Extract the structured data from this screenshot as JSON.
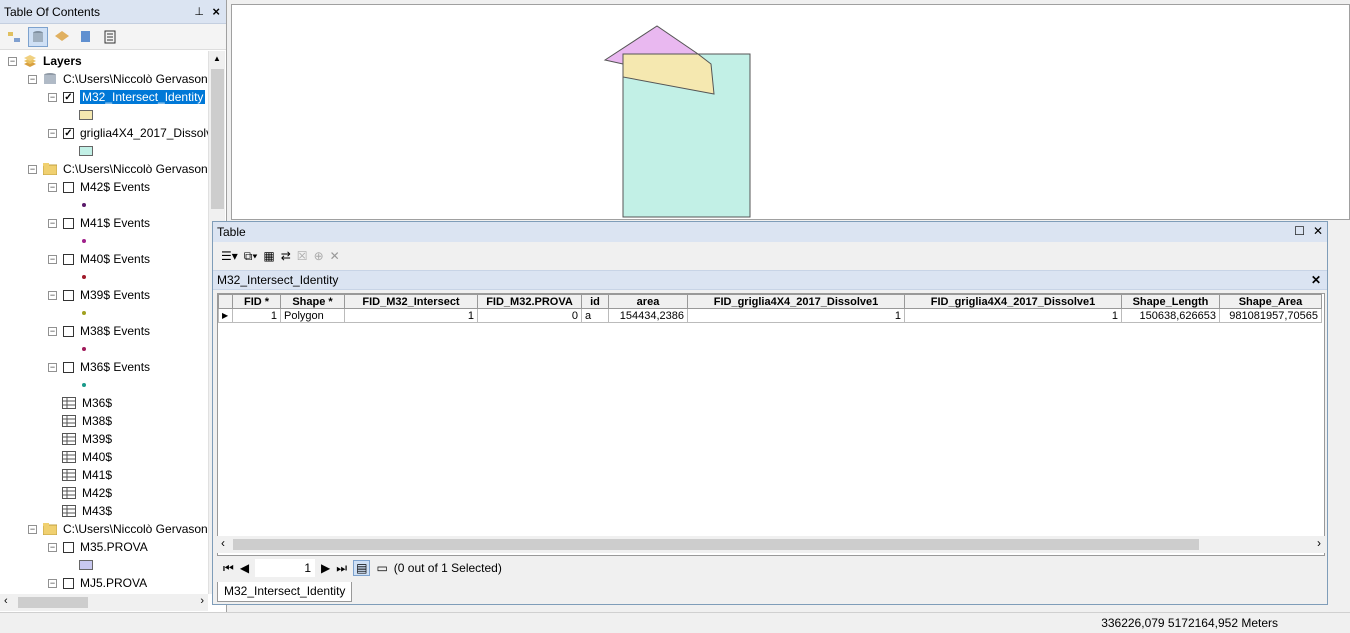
{
  "toc": {
    "title": "Table Of Contents",
    "pin_glyph": "⭾",
    "close_glyph": "✕",
    "items": {
      "layers": "Layers",
      "db1": "C:\\Users\\Niccolò Gervason",
      "layer_intersect": "M32_Intersect_Identity",
      "layer_griglia": "griglia4X4_2017_Dissolv",
      "folder1": "C:\\Users\\Niccolò Gervason",
      "ev42": "M42$ Events",
      "ev41": "M41$ Events",
      "ev40": "M40$ Events",
      "ev39": "M39$ Events",
      "ev38": "M38$ Events",
      "ev36": "M36$ Events",
      "t36": "M36$",
      "t38": "M38$",
      "t39": "M39$",
      "t40": "M40$",
      "t41": "M41$",
      "t42": "M42$",
      "t43": "M43$",
      "folder2": "C:\\Users\\Niccolò Gervason",
      "prova35": "M35.PROVA",
      "prova5": "MJ5.PROVA"
    },
    "colors": {
      "intersect_fill": "#f5e8b0",
      "griglia_fill": "#c2f0e6",
      "prova35_fill": "#c8c8f0"
    }
  },
  "table_window": {
    "title": "Table",
    "subtitle": "M32_Intersect_Identity",
    "columns": [
      "FID *",
      "Shape *",
      "FID_M32_Intersect",
      "FID_M32.PROVA",
      "id",
      "area",
      "FID_griglia4X4_2017_Dissolve1",
      "FID_griglia4X4_2017_Dissolve1",
      "Shape_Length",
      "Shape_Area"
    ],
    "rows": [
      [
        "1",
        "Polygon",
        "1",
        "0",
        "a",
        "154434,2386",
        "1",
        "1",
        "150638,626653",
        "981081957,70565"
      ]
    ],
    "record_value": "1",
    "selection_status": "(0 out of 1 Selected)",
    "tab_label": "M32_Intersect_Identity"
  },
  "map": {
    "pink_fill": "#e9b8f0",
    "yellow_fill": "#f5e8b0",
    "cyan_fill": "#c2f0e6"
  },
  "status": {
    "coordinates": "336226,079  5172164,952 Meters"
  }
}
